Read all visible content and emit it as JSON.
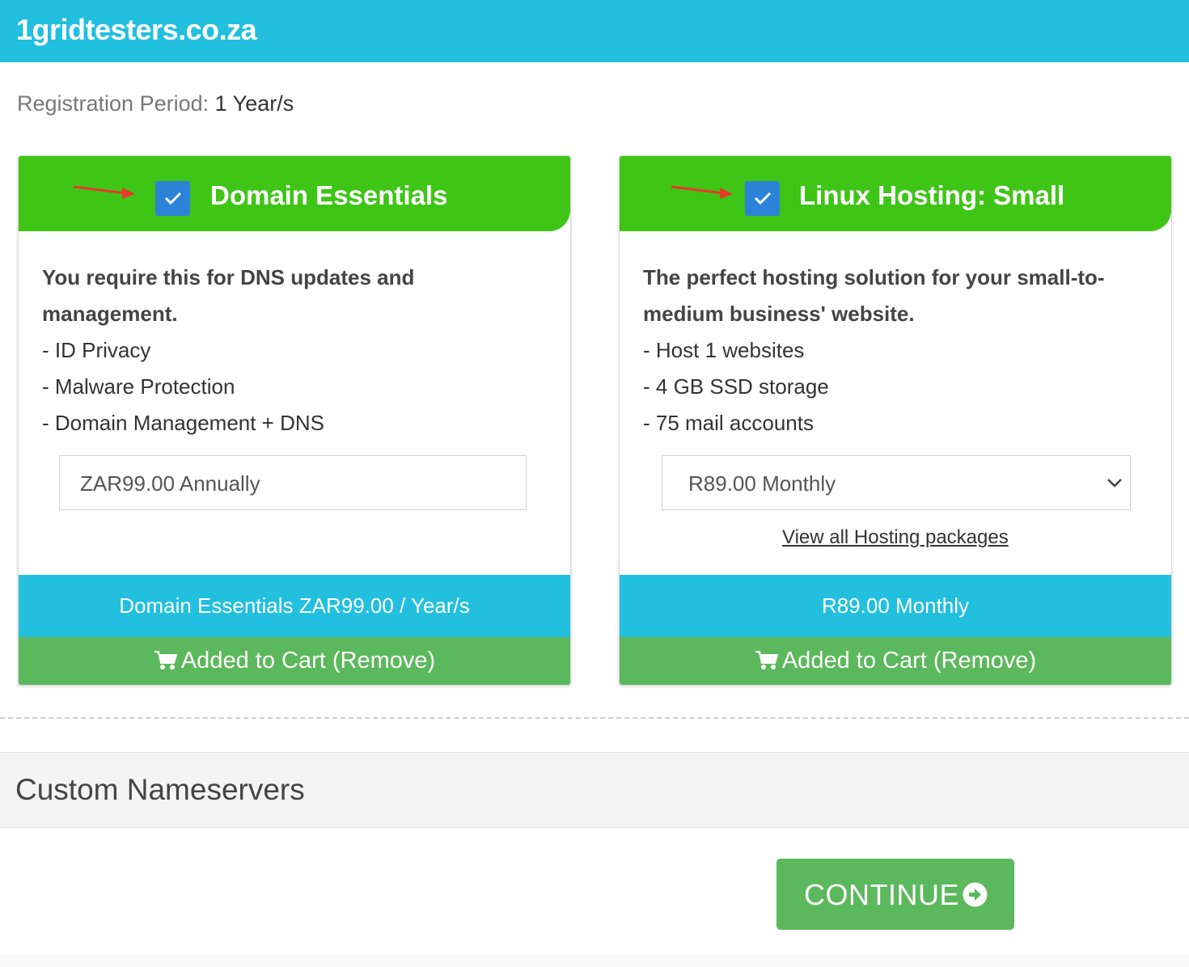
{
  "header": {
    "site_name": "1gridtesters.co.za"
  },
  "registration": {
    "label": "Registration Period:",
    "value": "1 Year/s"
  },
  "cards": [
    {
      "title": "Domain Essentials",
      "checked": true,
      "description": "You require this for DNS updates and management.",
      "features": [
        "- ID Privacy",
        "- Malware Protection",
        "- Domain Management + DNS"
      ],
      "price_option": "ZAR99.00 Annually",
      "summary": "Domain Essentials ZAR99.00 / Year/s",
      "cart_button": "Added to Cart (Remove)"
    },
    {
      "title": "Linux Hosting: Small",
      "checked": true,
      "description": "The perfect hosting solution for your small-to-medium business' website.",
      "features": [
        "- Host 1 websites",
        "- 4 GB SSD storage",
        "- 75 mail accounts"
      ],
      "price_option": "R89.00 Monthly",
      "link": "View all Hosting packages",
      "summary": "R89.00 Monthly",
      "cart_button": "Added to Cart (Remove)"
    }
  ],
  "nameservers": {
    "label": "Custom Nameservers"
  },
  "continue_button": {
    "label": "CONTINUE"
  },
  "colors": {
    "header": "#22bfdf",
    "card_head": "#3ec516",
    "checkbox": "#2b82d6",
    "cart_button": "#5cb85c",
    "annotation_arrow": "#e8392b"
  },
  "icons": [
    "red-arrow-annotation",
    "checkmark-icon",
    "cart-icon",
    "chevron-down-icon",
    "arrow-circle-right-icon"
  ]
}
